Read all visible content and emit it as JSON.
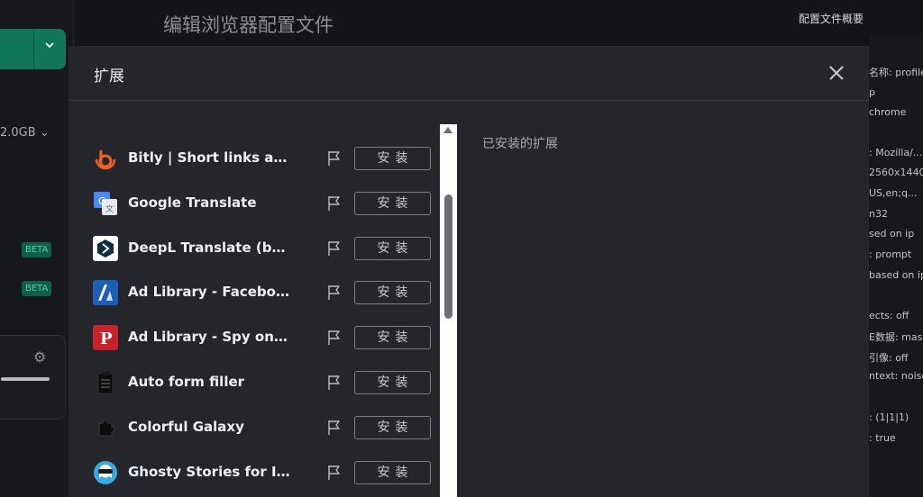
{
  "background": {
    "page_title": "编辑浏览器配置文件",
    "memory_text": "2.0GB",
    "memory_chevron": "⌄",
    "beta_badges": [
      "BETA",
      "BETA"
    ],
    "summary_title": "配置文件概要",
    "summary_lines": [
      "名称:  profile",
      "p",
      "chrome",
      ":  Mozilla/...",
      "2560x1440",
      "US,en;q...",
      "n32",
      "sed on ip",
      ":  prompt",
      "based on ip",
      "",
      "ects:  off",
      "E数据:  mask",
      "引像:  off",
      "ntext:  noise",
      "",
      ":  (1|1|1)",
      ":  true"
    ]
  },
  "modal": {
    "title": "扩展",
    "installed_label": "已安装的扩展",
    "install_label": "安装",
    "extensions": [
      {
        "name": "Bitly | Short links and...",
        "icon": "bitly-icon"
      },
      {
        "name": "Google Translate",
        "icon": "google-translate-icon"
      },
      {
        "name": "DeepL Translate (beta v...",
        "icon": "deepl-icon"
      },
      {
        "name": "Ad Library - Facebook ...",
        "icon": "ad-library-facebook-icon"
      },
      {
        "name": "Ad Library - Spy on Co...",
        "icon": "ad-library-spy-icon"
      },
      {
        "name": "Auto form filler",
        "icon": "clipboard-icon"
      },
      {
        "name": "Colorful Galaxy",
        "icon": "puzzle-icon"
      },
      {
        "name": "Ghosty Stories for Ins...",
        "icon": "ghost-icon"
      }
    ]
  }
}
